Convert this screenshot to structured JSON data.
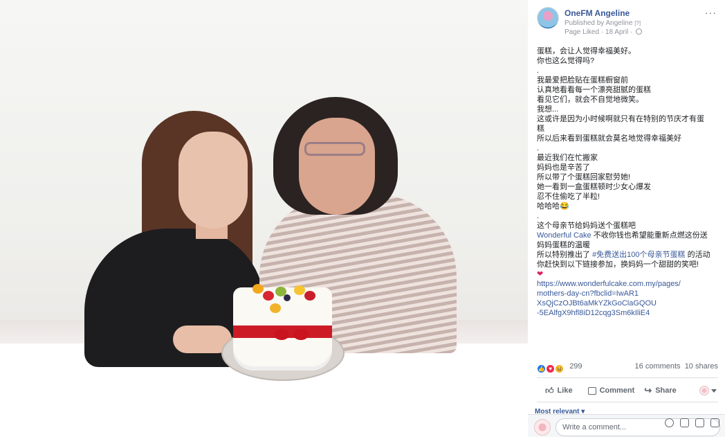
{
  "post": {
    "page_name": "OneFM Angeline",
    "published_by": "Published by Angeline",
    "published_by_help": "[?]",
    "meta": "Page Liked · 18 April ·",
    "more": "···",
    "lines": [
      {
        "text": "蛋糕，会让人觉得幸福美好。"
      },
      {
        "text": "你也这么觉得吗?"
      },
      {
        "text": "."
      },
      {
        "text": "我最爱把脸贴在蛋糕橱窗前"
      },
      {
        "text": "认真地看看每一个漂亮甜腻的蛋糕"
      },
      {
        "text": "看见它们，就会不自觉地微笑。"
      },
      {
        "text": "我想..."
      },
      {
        "text": "这或许是因为小时候啊就只有在特别的节庆才有蛋"
      },
      {
        "text": "糕"
      },
      {
        "text": "所以后来看到蛋糕就会莫名地觉得幸福美好"
      },
      {
        "text": "."
      },
      {
        "text": "最近我们在忙搬家"
      },
      {
        "text": "妈妈也是辛苦了"
      },
      {
        "text": "所以带了个蛋糕回家慰劳她!"
      },
      {
        "text": "她一看到一盒蛋糕顿时少女心爆发"
      },
      {
        "text": "忍不住偷吃了半粒!"
      },
      {
        "text": "哈哈哈😂"
      },
      {
        "text": "."
      },
      {
        "text": "这个母亲节给妈妈送个蛋糕吧"
      }
    ],
    "line_wc_link": "Wonderful Cake",
    "line_wc_rest": " 不收你钱也希望能重新点燃这份送",
    "line_wc_cont": "妈妈蛋糕的温暖",
    "line_promo_pre": "所以特别推出了 ",
    "line_promo_tag": "#免费送出100个母亲节蛋糕",
    "line_promo_post": " 的活动",
    "line_join": "你赶快到以下链接参加，换妈妈一个甜甜的笑吧!",
    "heart": "❤",
    "url_lines": [
      {
        "text": "https://www.wonderfulcake.com.my/pages/"
      },
      {
        "text": "mothers-day-cn?fbclid=IwAR1"
      },
      {
        "text": "XsQjCzOJBt6aMkYZkGoClaGQOU"
      },
      {
        "text": "-5EAlfgX9hfl8iD12cqg3Sm6kIliE4"
      }
    ]
  },
  "reactions": {
    "count": "299",
    "comments": "16 comments",
    "shares": "10 shares"
  },
  "actions": {
    "like": "Like",
    "comment": "Comment",
    "share": "Share"
  },
  "comments": {
    "sort_label": "Most relevant ▾",
    "placeholder": "Write a comment..."
  },
  "colors": {
    "link": "#385898",
    "like": "#1877f2",
    "love": "#f0284a",
    "haha": "#f7b125"
  }
}
